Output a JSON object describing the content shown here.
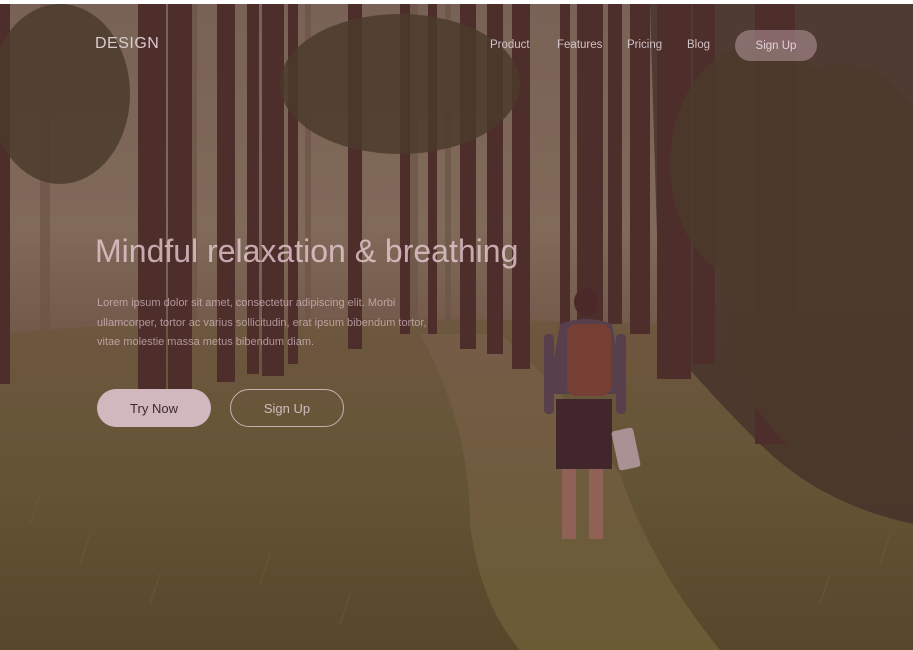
{
  "brand": {
    "logo": "DESIGN"
  },
  "nav": {
    "items": [
      {
        "label": "Product"
      },
      {
        "label": "Features"
      },
      {
        "label": "Pricing"
      },
      {
        "label": "Blog"
      }
    ],
    "signup_label": "Sign Up"
  },
  "hero": {
    "headline": "Mindful relaxation & breathing",
    "body": "Lorem ipsum dolor sit amet, consectetur adipiscing elit. Morbi ullamcorper, tortor ac varius sollicitudin, erat ipsum bibendum tortor, vitae molestie massa metus bibendum diam.",
    "primary_cta": "Try Now",
    "secondary_cta": "Sign Up",
    "background": "forest-path-hiker-photo"
  },
  "colors": {
    "overlay": "#6e2d3c",
    "primary_button": "#d0b8be",
    "text_light": "#d9ccd0"
  }
}
